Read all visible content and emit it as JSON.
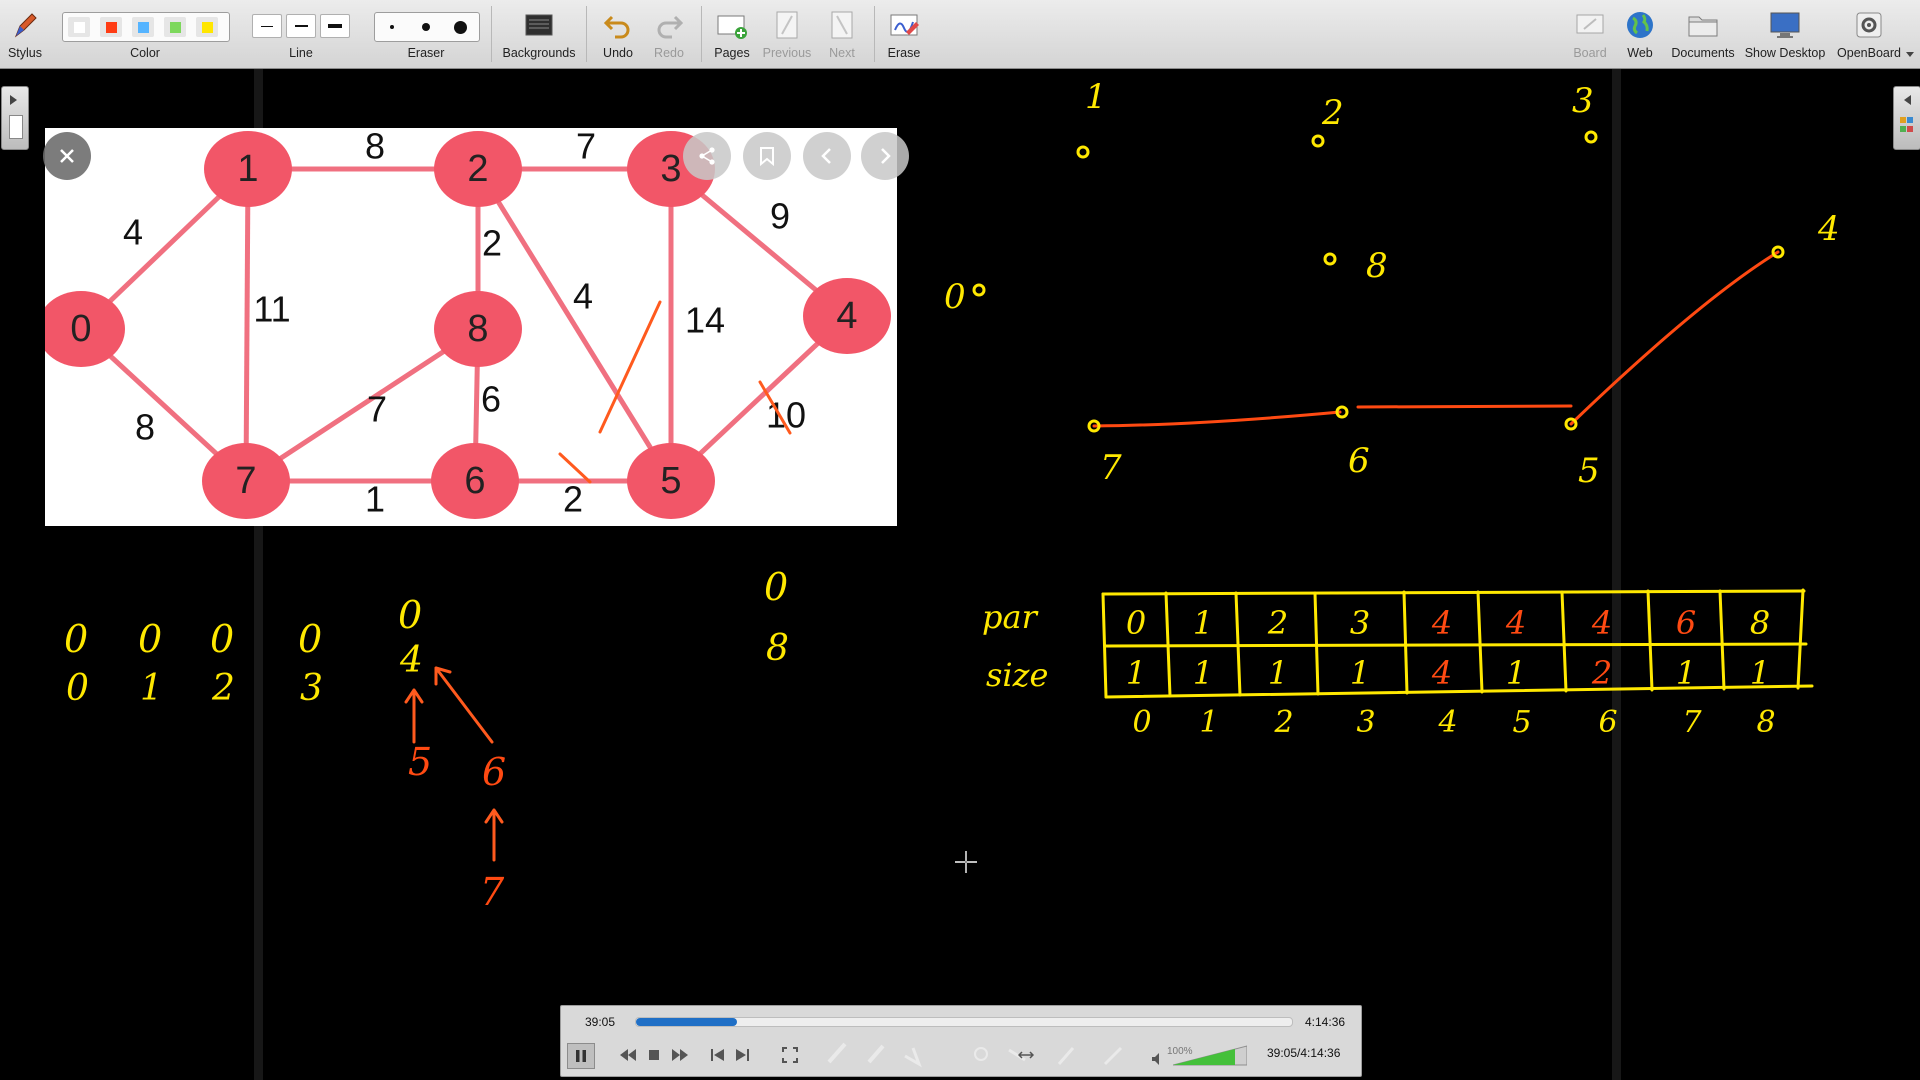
{
  "toolbar": {
    "stylus_label": "Stylus",
    "color_label": "Color",
    "line_label": "Line",
    "eraser_label": "Eraser",
    "backgrounds_label": "Backgrounds",
    "undo_label": "Undo",
    "redo_label": "Redo",
    "pages_label": "Pages",
    "previous_label": "Previous",
    "next_label": "Next",
    "erase_label": "Erase",
    "board_label": "Board",
    "web_label": "Web",
    "documents_label": "Documents",
    "show_desktop_label": "Show Desktop",
    "openboard_label": "OpenBoard",
    "colors": [
      "#ffffff",
      "#ff3c14",
      "#55b4ff",
      "#7dd85c",
      "#ffe600"
    ]
  },
  "graph": {
    "node_color": "#f25668",
    "edge_color": "#f07080",
    "nodes": [
      "0",
      "1",
      "2",
      "3",
      "4",
      "5",
      "6",
      "7",
      "8"
    ],
    "edge_weights": [
      "4",
      "8",
      "7",
      "9",
      "11",
      "2",
      "4",
      "14",
      "10",
      "8",
      "7",
      "6",
      "1",
      "2",
      "2"
    ]
  },
  "notes": {
    "upper_points": [
      "1",
      "2",
      "3",
      "8",
      "4",
      "0",
      "7",
      "6",
      "5"
    ],
    "left_column_tops": [
      "0",
      "0",
      "0",
      "0",
      "0",
      "0"
    ],
    "left_column_bottoms": [
      "0",
      "1",
      "2",
      "3",
      "4",
      "8"
    ],
    "chain_left": [
      "5",
      "6",
      "7"
    ]
  },
  "dsu_table": {
    "par_label": "par",
    "size_label": "size",
    "par": [
      "0",
      "1",
      "2",
      "3",
      "4",
      "4",
      "4",
      "6",
      "8"
    ],
    "size": [
      "1",
      "1",
      "1",
      "1",
      "4",
      "1",
      "2",
      "1",
      "1"
    ],
    "index": [
      "0",
      "1",
      "2",
      "3",
      "4",
      "5",
      "6",
      "7",
      "8"
    ]
  },
  "player": {
    "current_time": "39:05",
    "total_time": "4:14:36",
    "status_time": "39:05/4:14:36",
    "volume": "100%",
    "progress_fraction": 0.154
  }
}
